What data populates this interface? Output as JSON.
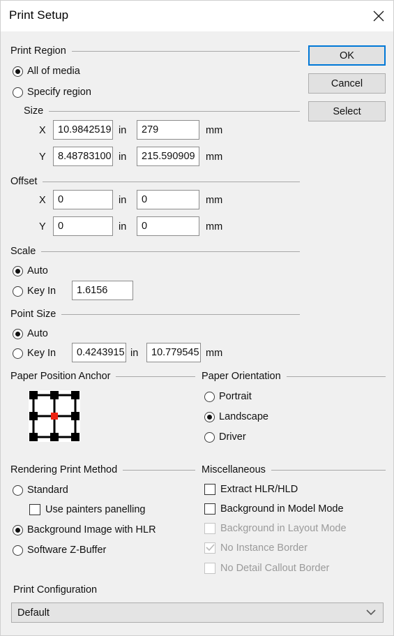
{
  "window": {
    "title": "Print Setup",
    "close_icon": "close-icon"
  },
  "buttons": {
    "ok": "OK",
    "cancel": "Cancel",
    "select": "Select"
  },
  "print_region": {
    "legend": "Print Region",
    "options": [
      {
        "label": "All of media",
        "checked": true
      },
      {
        "label": "Specify region",
        "checked": false
      }
    ]
  },
  "size": {
    "legend": "Size",
    "unit_in": "in",
    "unit_mm": "mm",
    "rows": [
      {
        "axis": "X",
        "inches": "10.9842519",
        "mm": "279"
      },
      {
        "axis": "Y",
        "inches": "8.48783100",
        "mm": "215.590909"
      }
    ]
  },
  "offset": {
    "legend": "Offset",
    "unit_in": "in",
    "unit_mm": "mm",
    "rows": [
      {
        "axis": "X",
        "inches": "0",
        "mm": "0"
      },
      {
        "axis": "Y",
        "inches": "0",
        "mm": "0"
      }
    ]
  },
  "scale": {
    "legend": "Scale",
    "auto_label": "Auto",
    "auto_checked": true,
    "keyin_label": "Key In",
    "keyin_checked": false,
    "keyin_value": "1.6156"
  },
  "point_size": {
    "legend": "Point Size",
    "auto_label": "Auto",
    "auto_checked": true,
    "keyin_label": "Key In",
    "keyin_checked": false,
    "keyin_inches": "0.4243915",
    "unit_in": "in",
    "keyin_mm": "10.779545",
    "unit_mm": "mm"
  },
  "paper_anchor": {
    "legend": "Paper Position Anchor",
    "selected_position": "center",
    "handle_color": "#000000",
    "selected_color": "#ee2211"
  },
  "paper_orientation": {
    "legend": "Paper Orientation",
    "options": [
      {
        "label": "Portrait",
        "checked": false
      },
      {
        "label": "Landscape",
        "checked": true
      },
      {
        "label": "Driver",
        "checked": false
      }
    ]
  },
  "rendering": {
    "legend": "Rendering Print Method",
    "options": [
      {
        "label": "Standard",
        "checked": false
      },
      {
        "label": "Background Image with HLR",
        "checked": true
      },
      {
        "label": "Software Z-Buffer",
        "checked": false
      }
    ],
    "painters_panelling": {
      "label": "Use painters panelling",
      "checked": false
    }
  },
  "miscellaneous": {
    "legend": "Miscellaneous",
    "options": [
      {
        "label": "Extract HLR/HLD",
        "checked": false,
        "disabled": false
      },
      {
        "label": "Background in Model Mode",
        "checked": false,
        "disabled": false
      },
      {
        "label": "Background in Layout Mode",
        "checked": false,
        "disabled": true
      },
      {
        "label": "No Instance Border",
        "checked": true,
        "disabled": true
      },
      {
        "label": "No Detail Callout Border",
        "checked": false,
        "disabled": true
      }
    ]
  },
  "print_configuration": {
    "label": "Print Configuration",
    "value": "Default",
    "arrow_icon": "chevron-down-icon"
  },
  "colors": {
    "dialog_bg": "#f0f0f0",
    "titlebar_bg": "#ffffff",
    "accent": "#0078d7",
    "field_bg": "#ffffff",
    "disabled_text": "#9a9a9a"
  }
}
